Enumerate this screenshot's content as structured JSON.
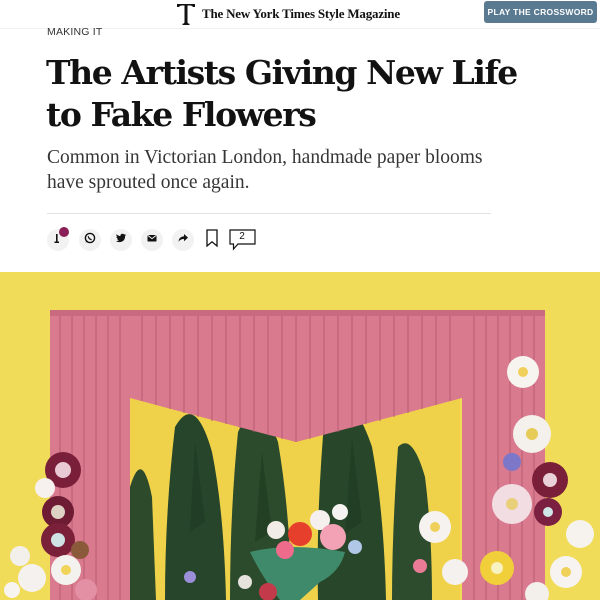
{
  "header": {
    "brand": "The New York Times Style Magazine",
    "crossword_button": "PLAY THE CROSSWORD"
  },
  "article": {
    "kicker": "MAKING IT",
    "headline": "The Artists Giving New Life to Fake Flowers",
    "dek": "Common in Victorian London, handmade paper blooms have sprouted once again."
  },
  "share": {
    "comments_count": "2",
    "icons": [
      "gift-icon",
      "whatsapp-icon",
      "twitter-icon",
      "email-icon",
      "share-icon",
      "bookmark-icon",
      "comments-icon"
    ]
  },
  "colors": {
    "crossword_button": "#5a7a92",
    "gift_badge": "#8b1e57",
    "hero_background": "#f1dc5a",
    "curtain": "#d97a8e"
  }
}
